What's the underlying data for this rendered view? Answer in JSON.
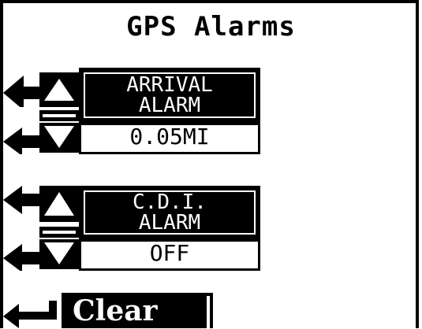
{
  "screen": {
    "title": "GPS Alarms"
  },
  "arrival_alarm": {
    "label_line1": "ARRIVAL",
    "label_line2": "ALARM",
    "value": "0.05MI"
  },
  "cdi_alarm": {
    "label_line1": "C.D.I.",
    "label_line2": "ALARM",
    "value": "OFF"
  },
  "clear_button": {
    "label": "Clear"
  },
  "icons": [
    "left-arrow-icon",
    "up-arrow-icon",
    "down-arrow-icon",
    "equals-icon",
    "return-arrow-icon"
  ]
}
